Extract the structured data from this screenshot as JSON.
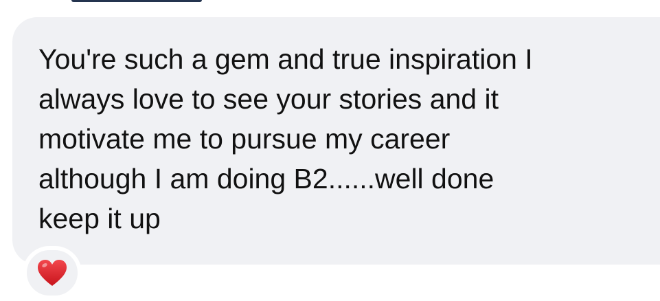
{
  "message": {
    "lines": [
      "You're such a gem and true inspiration I",
      "always love to see your stories and it",
      "motivate me to pursue my career",
      "although I am doing B2......well done",
      "keep it up"
    ]
  },
  "reaction": {
    "icon": "red-heart-icon",
    "color": "#e0242b"
  },
  "colors": {
    "bubble": "#f0f1f4",
    "text": "#111111"
  }
}
